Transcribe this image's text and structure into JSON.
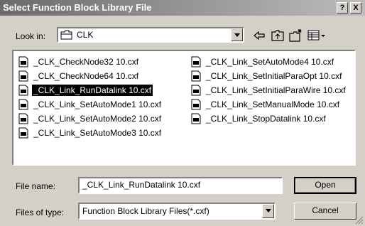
{
  "dialog": {
    "title": "Select Function Block Library File",
    "help_label": "?",
    "close_label": "X"
  },
  "look_in": {
    "label": "Look in:",
    "value": "CLK"
  },
  "toolbar": {
    "back_icon": "back-arrow-icon",
    "up_icon": "up-folder-icon",
    "new_folder_icon": "new-folder-icon",
    "view_menu_icon": "view-menu-icon"
  },
  "files": {
    "column1": [
      {
        "name": "_CLK_CheckNode32 10.cxf"
      },
      {
        "name": "_CLK_CheckNode64 10.cxf"
      },
      {
        "name": "_CLK_Link_RunDatalink 10.cxf",
        "selected": true
      },
      {
        "name": "_CLK_Link_SetAutoMode1 10.cxf"
      },
      {
        "name": "_CLK_Link_SetAutoMode2 10.cxf"
      },
      {
        "name": "_CLK_Link_SetAutoMode3 10.cxf"
      }
    ],
    "column2": [
      {
        "name": "_CLK_Link_SetAutoMode4 10.cxf"
      },
      {
        "name": "_CLK_Link_SetInitialParaOpt 10.cxf"
      },
      {
        "name": "_CLK_Link_SetInitialParaWire 10.cxf"
      },
      {
        "name": "_CLK_Link_SetManualMode 10.cxf"
      },
      {
        "name": "_CLK_Link_StopDatalink 10.cxf"
      }
    ]
  },
  "file_name": {
    "label": "File name:",
    "value": "_CLK_Link_RunDatalink 10.cxf"
  },
  "file_type": {
    "label": "Files of type:",
    "value": "Function Block Library Files(*.cxf)"
  },
  "buttons": {
    "open": "Open",
    "cancel": "Cancel"
  }
}
